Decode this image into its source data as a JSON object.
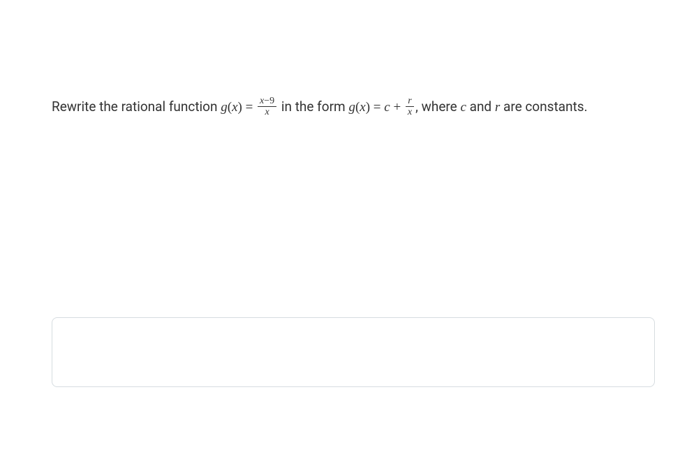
{
  "prompt": {
    "part1": "Rewrite the rational function ",
    "fn_left": "g",
    "fn_paren_open": "(",
    "fn_var": "x",
    "fn_paren_close": ") = ",
    "frac1_num_var": "x",
    "frac1_num_const": "−9",
    "frac1_den": "x",
    "part2": " in the form ",
    "fn2_left": "g",
    "fn2_paren_open": "(",
    "fn2_var": "x",
    "fn2_paren_close": ") = ",
    "c_var": "c",
    "plus": " + ",
    "frac2_num": "r",
    "frac2_den": "x",
    "comma": ", ",
    "part3": "where ",
    "c_var2": "c",
    "part4": " and ",
    "r_var": "r",
    "part5": " are constants."
  },
  "answer": {
    "value": "",
    "placeholder": ""
  }
}
